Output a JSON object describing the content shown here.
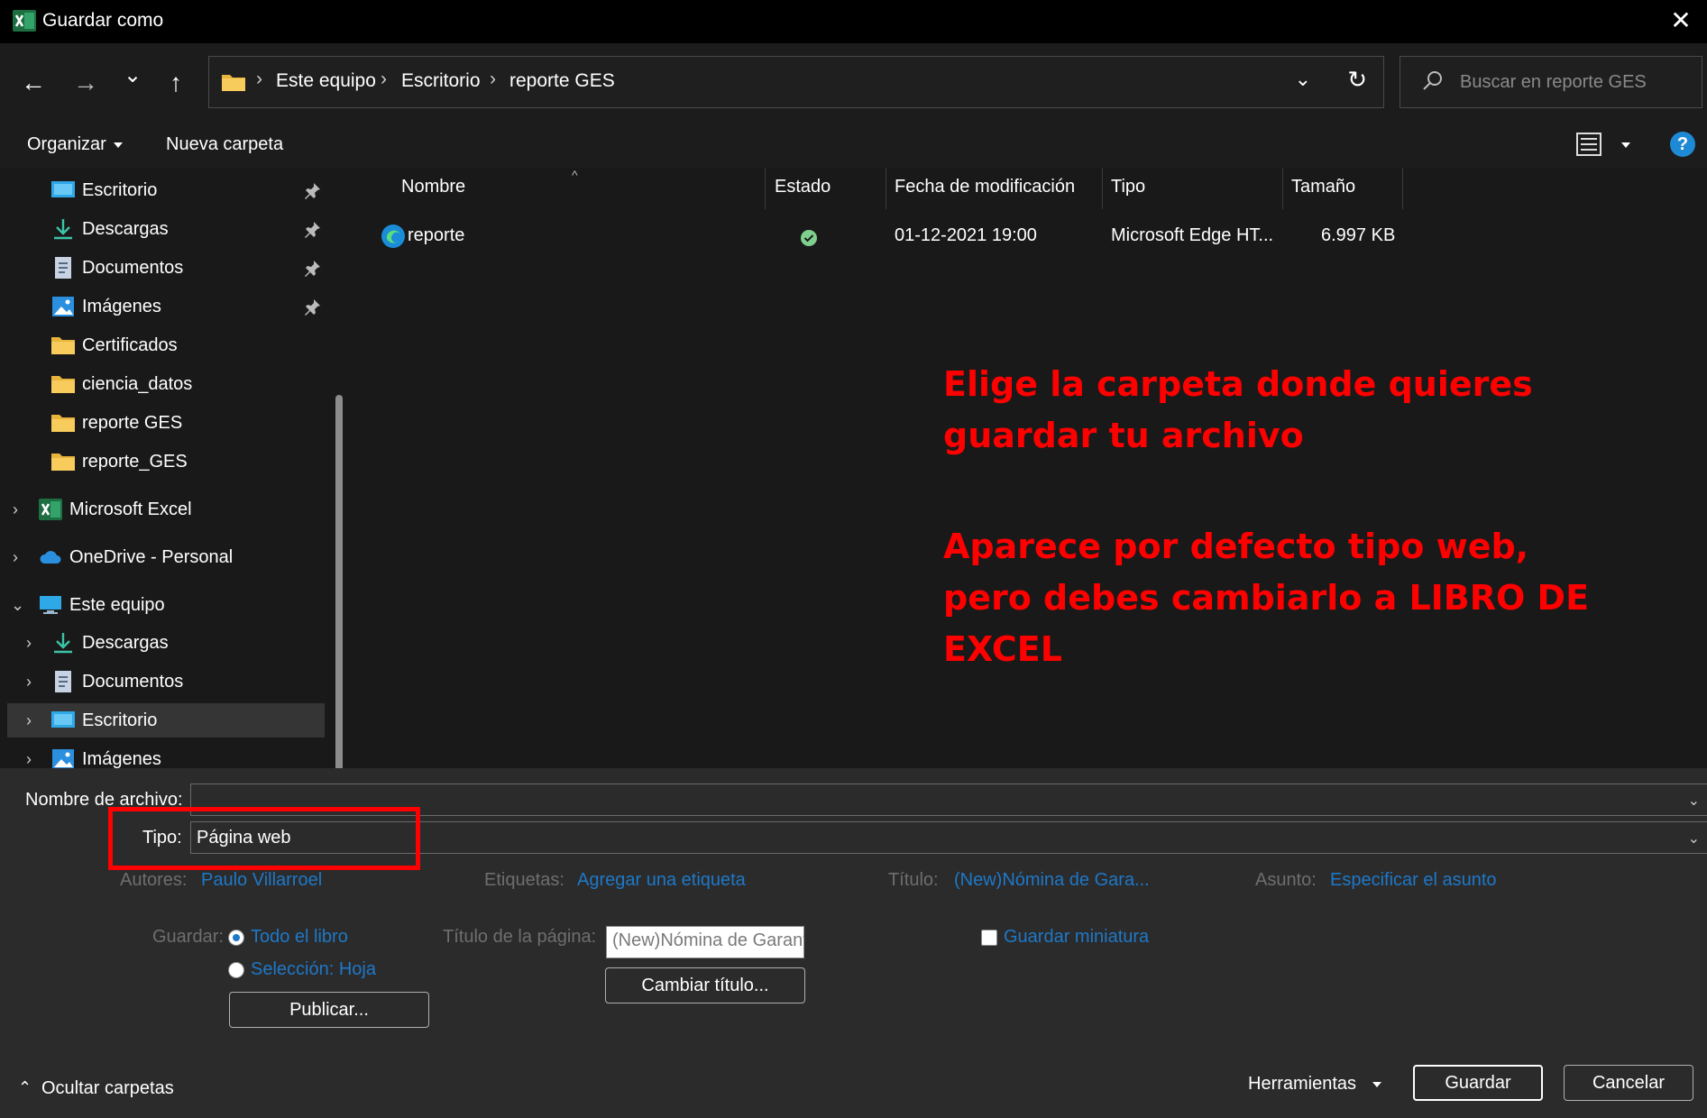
{
  "window": {
    "title": "Guardar como",
    "close_glyph": "✕"
  },
  "nav": {
    "back_glyph": "←",
    "forward_glyph": "→",
    "recent_glyph": "⌄",
    "up_glyph": "↑",
    "breadcrumbs": [
      "Este equipo",
      "Escritorio",
      "reporte GES"
    ],
    "separator": "›",
    "dropdown_glyph": "⌄",
    "refresh_glyph": "↻",
    "search_placeholder": "Buscar en reporte GES"
  },
  "toolbar": {
    "organize_label": "Organizar",
    "new_folder_label": "Nueva carpeta",
    "help_label": "?"
  },
  "sidebar": {
    "quick_access": [
      {
        "label": "Escritorio",
        "icon": "desktop-icon",
        "pinned": true
      },
      {
        "label": "Descargas",
        "icon": "download-icon",
        "pinned": true
      },
      {
        "label": "Documentos",
        "icon": "document-icon",
        "pinned": true
      },
      {
        "label": "Imágenes",
        "icon": "pictures-icon",
        "pinned": true
      },
      {
        "label": "Certificados",
        "icon": "folder-icon",
        "pinned": false
      },
      {
        "label": "ciencia_datos",
        "icon": "folder-icon",
        "pinned": false
      },
      {
        "label": "reporte GES",
        "icon": "folder-icon",
        "pinned": false
      },
      {
        "label": "reporte_GES",
        "icon": "folder-icon",
        "pinned": false
      }
    ],
    "roots": [
      {
        "label": "Microsoft Excel",
        "icon": "excel-icon",
        "expanded": false
      },
      {
        "label": "OneDrive - Personal",
        "icon": "cloud-icon",
        "expanded": false
      },
      {
        "label": "Este equipo",
        "icon": "computer-icon",
        "expanded": true
      }
    ],
    "this_pc_children": [
      {
        "label": "Descargas",
        "icon": "download-icon",
        "selected": false
      },
      {
        "label": "Documentos",
        "icon": "document-icon",
        "selected": false
      },
      {
        "label": "Escritorio",
        "icon": "desktop-icon",
        "selected": true
      },
      {
        "label": "Imágenes",
        "icon": "pictures-icon",
        "selected": false
      }
    ],
    "chevron_closed": "›",
    "chevron_open": "⌄"
  },
  "file_list": {
    "columns": [
      "Nombre",
      "Estado",
      "Fecha de modificación",
      "Tipo",
      "Tamaño"
    ],
    "sort_glyph": "^",
    "rows": [
      {
        "name": "reporte",
        "status": "synced",
        "modified": "01-12-2021 19:00",
        "type": "Microsoft Edge HT...",
        "size": "6.997 KB"
      }
    ]
  },
  "annotations": {
    "line1": "Elige la carpeta donde quieres",
    "line2": "guardar tu archivo",
    "line3": "Aparece por defecto tipo web,",
    "line4": "pero debes cambiarlo a LIBRO DE",
    "line5": "EXCEL",
    "color": "#ff0000"
  },
  "save_form": {
    "filename_label": "Nombre de archivo:",
    "filename_value": "",
    "type_label": "Tipo:",
    "type_value": "Página web",
    "authors_label": "Autores:",
    "authors_value": "Paulo Villarroel",
    "tags_label": "Etiquetas:",
    "tags_value": "Agregar una etiqueta",
    "title_label": "Título:",
    "title_value": "(New)Nómina de Gara...",
    "subject_label": "Asunto:",
    "subject_value": "Especificar el asunto",
    "save_label": "Guardar:",
    "option_whole": "Todo el libro",
    "option_selection": "Selección: Hoja",
    "publish_button": "Publicar...",
    "page_title_label": "Título de la página:",
    "page_title_value": "(New)Nómina de Garant",
    "change_title_button": "Cambiar título...",
    "thumbnail_label": "Guardar miniatura"
  },
  "footer": {
    "hide_folders": "Ocultar carpetas",
    "tools": "Herramientas",
    "save_button": "Guardar",
    "cancel_button": "Cancelar"
  },
  "colors": {
    "accent": "#1e78c8",
    "highlight": "#ff0000",
    "background": "#191919",
    "panel": "#2b2b2b"
  }
}
